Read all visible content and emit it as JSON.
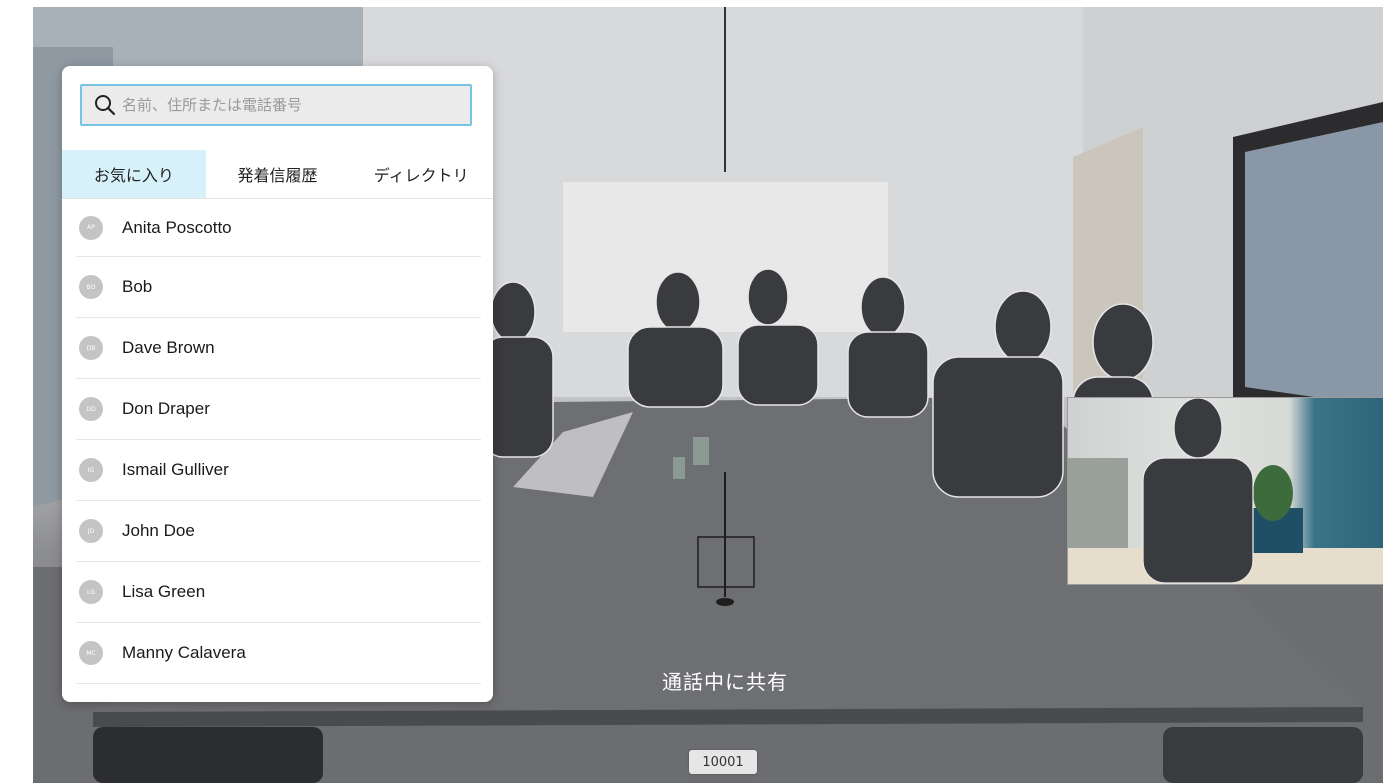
{
  "search": {
    "placeholder": "名前、住所または電話番号",
    "value": "",
    "icon": "search-icon"
  },
  "tabs": [
    {
      "label": "お気に入り",
      "active": true
    },
    {
      "label": "発着信履歴",
      "active": false
    },
    {
      "label": "ディレクトリ",
      "active": false
    }
  ],
  "contacts": [
    {
      "initials": "AP",
      "name": "Anita Poscotto"
    },
    {
      "initials": "BO",
      "name": "Bob"
    },
    {
      "initials": "DB",
      "name": "Dave Brown"
    },
    {
      "initials": "DD",
      "name": "Don Draper"
    },
    {
      "initials": "IG",
      "name": "Ismail Gulliver"
    },
    {
      "initials": "JD",
      "name": "John Doe"
    },
    {
      "initials": "LG",
      "name": "Lisa Green"
    },
    {
      "initials": "MC",
      "name": "Manny Calavera"
    }
  ],
  "call": {
    "share_label": "通話中に共有",
    "number": "10001"
  },
  "colors": {
    "accent": "#79c4e2",
    "active_tab": "#d6f1f9",
    "avatar": "#c4c4c4"
  }
}
